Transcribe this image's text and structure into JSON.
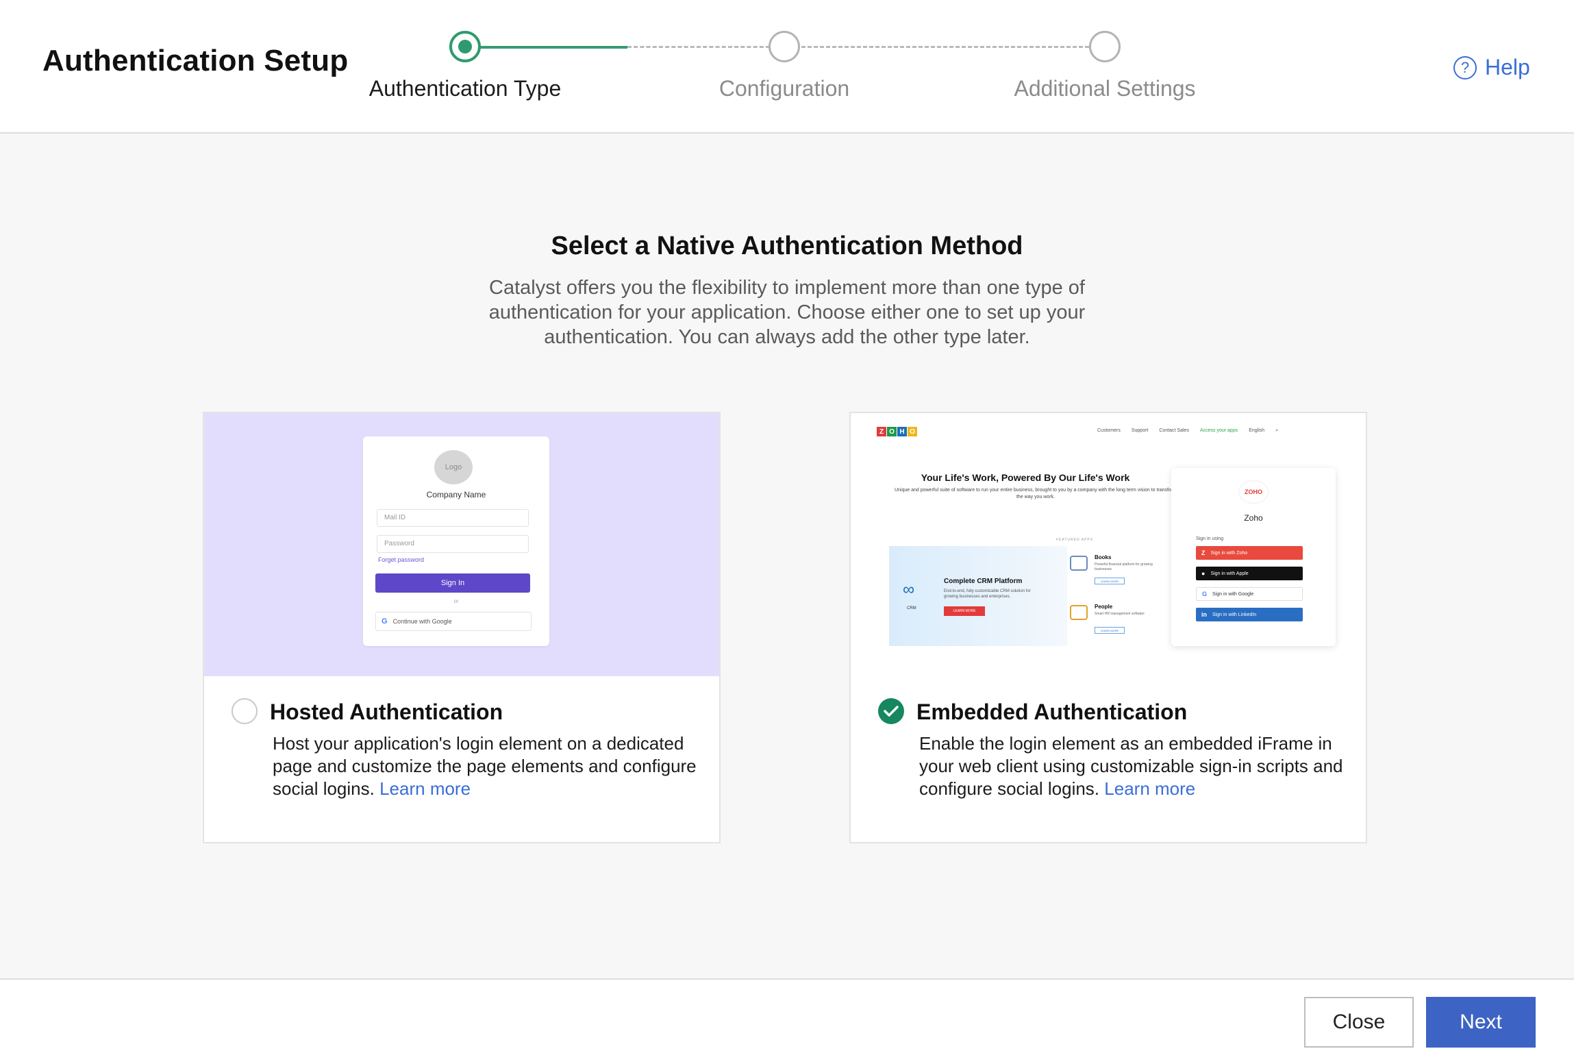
{
  "header": {
    "title": "Authentication Setup",
    "steps": [
      {
        "label": "Authentication Type",
        "state": "active"
      },
      {
        "label": "Configuration",
        "state": "pending"
      },
      {
        "label": "Additional Settings",
        "state": "pending"
      }
    ],
    "help_label": "Help",
    "help_icon": "question-circle-icon"
  },
  "main": {
    "heading": "Select a Native Authentication Method",
    "description": "Catalyst offers you the flexibility to implement more than one type of authentication for your application. Choose either one to set up your authentication. You can always add the other type later.",
    "options": [
      {
        "title": "Hosted Authentication",
        "description": "Host your application's login element on a dedicated page and customize the page elements and configure social logins.",
        "learn_more": "Learn more",
        "selected": false
      },
      {
        "title": "Embedded Authentication",
        "description": "Enable the login element as an embedded iFrame in your web client using customizable sign-in scripts and configure social logins.",
        "learn_more": "Learn more",
        "selected": true
      }
    ]
  },
  "hosted_preview": {
    "logo": "Logo",
    "company": "Company Name",
    "mail_placeholder": "Mail ID",
    "password_placeholder": "Password",
    "forget": "Forget password",
    "signin": "Sign In",
    "or": "or",
    "google": "Continue with Google"
  },
  "embedded_preview": {
    "brand_letters": [
      "Z",
      "O",
      "H",
      "O"
    ],
    "nav": [
      "Customers",
      "Support",
      "Contact Sales",
      "Access your apps",
      "English"
    ],
    "heading": "Your Life's Work, Powered By Our Life's Work",
    "sub": "Unique and powerful suite of software to run your entire business, brought to you by a company with the long term vision to transform the way you work.",
    "featured": "FEATURED APPS",
    "crm_title": "Complete CRM Platform",
    "crm_sub": "End-to-end, fully customizable CRM solution for growing businesses and enterprises.",
    "crm_label": "CRM",
    "crm_btn": "LEARN MORE",
    "apps": [
      {
        "name": "Books",
        "desc": "Powerful financial platform for growing businesses",
        "btn": "LEARN MORE"
      },
      {
        "name": "People",
        "desc": "Smart HR management software",
        "btn": "LEARN MORE"
      }
    ],
    "signin_brand": "Zoho",
    "signin_using": "Sign in using",
    "signin_buttons": [
      {
        "label": "Sign in with Zoho",
        "icon": "Z",
        "color": "#e84a3d"
      },
      {
        "label": "Sign in with Apple",
        "icon": "",
        "color": "#111111"
      },
      {
        "label": "Sign in with Google",
        "icon": "G",
        "color": "#ffffff"
      },
      {
        "label": "Sign in with LinkedIn",
        "icon": "in",
        "color": "#2a6ec3"
      }
    ]
  },
  "footer": {
    "close_label": "Close",
    "next_label": "Next"
  },
  "colors": {
    "accent": "#3d64c4",
    "step_active": "#2f9a6e",
    "link": "#3a6dd8",
    "selected_check": "#16875e"
  }
}
